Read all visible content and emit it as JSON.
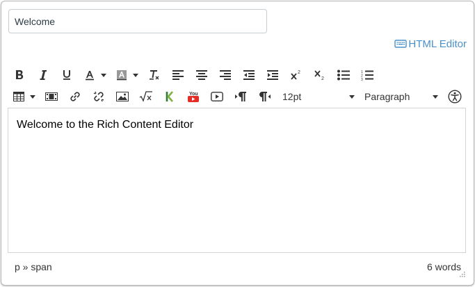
{
  "title_field": {
    "value": "Welcome"
  },
  "html_editor_link": {
    "label": "HTML Editor",
    "icon": "keyboard-icon",
    "color": "#4a90c9"
  },
  "toolbar": {
    "row1": [
      {
        "name": "bold-button",
        "icon": "bold-icon"
      },
      {
        "name": "italic-button",
        "icon": "italic-icon"
      },
      {
        "name": "underline-button",
        "icon": "underline-icon"
      },
      {
        "name": "text-color-button",
        "icon": "text-color-icon"
      },
      {
        "name": "background-color-button",
        "icon": "background-color-icon"
      },
      {
        "name": "clear-formatting-button",
        "icon": "clear-formatting-icon"
      },
      {
        "name": "align-left-button",
        "icon": "align-left-icon"
      },
      {
        "name": "align-center-button",
        "icon": "align-center-icon"
      },
      {
        "name": "align-right-button",
        "icon": "align-right-icon"
      },
      {
        "name": "outdent-button",
        "icon": "outdent-icon"
      },
      {
        "name": "indent-button",
        "icon": "indent-icon"
      },
      {
        "name": "superscript-button",
        "icon": "superscript-icon"
      },
      {
        "name": "subscript-button",
        "icon": "subscript-icon"
      },
      {
        "name": "bullet-list-button",
        "icon": "bullet-list-icon"
      },
      {
        "name": "numbered-list-button",
        "icon": "numbered-list-icon"
      }
    ],
    "row2": [
      {
        "name": "table-button",
        "icon": "table-icon"
      },
      {
        "name": "media-button",
        "icon": "film-icon"
      },
      {
        "name": "link-button",
        "icon": "link-icon"
      },
      {
        "name": "unlink-button",
        "icon": "unlink-icon"
      },
      {
        "name": "image-button",
        "icon": "image-icon"
      },
      {
        "name": "equation-button",
        "icon": "square-root-icon"
      },
      {
        "name": "kaltura-button",
        "icon": "kaltura-icon"
      },
      {
        "name": "youtube-button",
        "icon": "youtube-icon"
      },
      {
        "name": "media-record-button",
        "icon": "play-box-icon"
      },
      {
        "name": "ltr-button",
        "icon": "ltr-paragraph-icon"
      },
      {
        "name": "rtl-button",
        "icon": "rtl-paragraph-icon"
      }
    ],
    "font_size": {
      "value": "12pt"
    },
    "block_format": {
      "value": "Paragraph"
    },
    "accessibility": {
      "icon": "accessibility-icon"
    },
    "youtube_text": "You"
  },
  "editor": {
    "content": "Welcome to the Rich Content Editor"
  },
  "status_bar": {
    "path": "p » span",
    "word_count": "6 words"
  }
}
